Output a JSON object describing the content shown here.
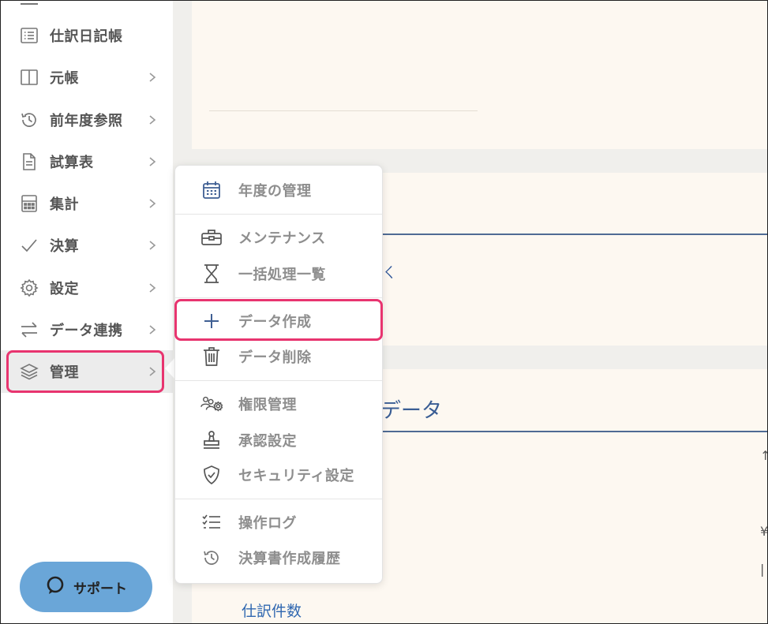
{
  "sidebar": {
    "items": [
      {
        "label": "仕訳日記帳",
        "icon": "list-icon",
        "chevron": false
      },
      {
        "label": "元帳",
        "icon": "book-icon",
        "chevron": true
      },
      {
        "label": "前年度参照",
        "icon": "history-icon",
        "chevron": true
      },
      {
        "label": "試算表",
        "icon": "document-icon",
        "chevron": true
      },
      {
        "label": "集計",
        "icon": "calculator-icon",
        "chevron": true
      },
      {
        "label": "決算",
        "icon": "check-icon",
        "chevron": true
      },
      {
        "label": "設定",
        "icon": "gear-icon",
        "chevron": true
      },
      {
        "label": "データ連携",
        "icon": "exchange-icon",
        "chevron": true
      },
      {
        "label": "管理",
        "icon": "layers-icon",
        "chevron": true,
        "active": true
      }
    ],
    "support_label": "サポート"
  },
  "menu": {
    "items": [
      {
        "label": "年度の管理",
        "icon": "calendar-icon"
      },
      {
        "label": "メンテナンス",
        "icon": "toolbox-icon"
      },
      {
        "label": "一括処理一覧",
        "icon": "hourglass-icon"
      },
      {
        "label": "データ作成",
        "icon": "plus-icon",
        "highlighted": true
      },
      {
        "label": "データ削除",
        "icon": "trash-icon"
      },
      {
        "label": "権限管理",
        "icon": "users-gear-icon"
      },
      {
        "label": "承認設定",
        "icon": "stamp-icon"
      },
      {
        "label": "セキュリティ設定",
        "icon": "shield-check-icon"
      },
      {
        "label": "操作ログ",
        "icon": "checklist-icon"
      },
      {
        "label": "決算書作成履歴",
        "icon": "history-icon"
      }
    ]
  },
  "main": {
    "section_title_fragment": "データ",
    "count_label": "仕訳件数"
  },
  "colors": {
    "highlight": "#e8346f",
    "accent_blue": "#4f6b94",
    "support_button": "#6aa6d8",
    "panel_bg": "#fdf8f1"
  }
}
